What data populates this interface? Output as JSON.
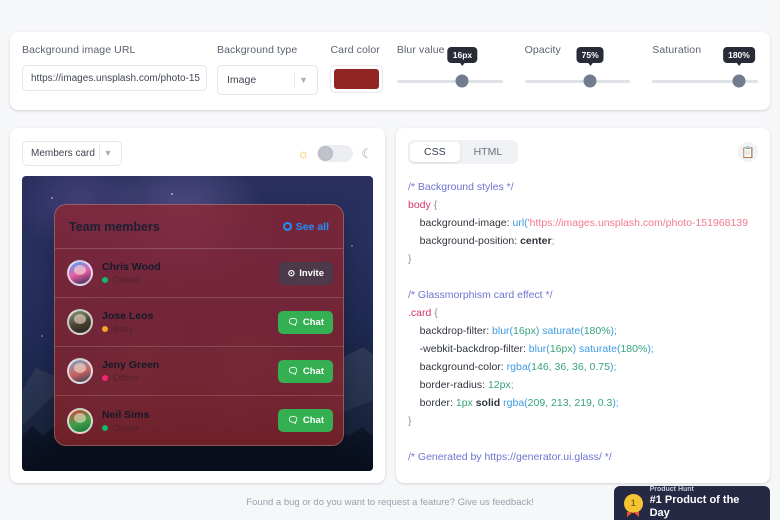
{
  "controls": {
    "bg_url": {
      "label": "Background image URL",
      "value": "https://images.unsplash.com/photo-15"
    },
    "bg_type": {
      "label": "Background type",
      "value": "Image"
    },
    "card_color": {
      "label": "Card color",
      "value": "#922424"
    },
    "blur": {
      "label": "Blur value",
      "value": "16px",
      "knob_pct": 62
    },
    "opacity": {
      "label": "Opacity",
      "value": "75%",
      "knob_pct": 62
    },
    "saturation": {
      "label": "Saturation",
      "value": "180%",
      "knob_pct": 82
    }
  },
  "preview": {
    "component_select": "Members card",
    "theme": {
      "sun_icon": "sun-icon",
      "moon_icon": "moon-icon",
      "state": "light"
    },
    "card": {
      "title": "Team members",
      "see_all": "See all",
      "members": [
        {
          "name": "Chris Wood",
          "status": "Online",
          "status_color": "#12b76a",
          "action": "Invite",
          "action_icon": "invite-icon",
          "action_kind": "invite"
        },
        {
          "name": "Jose Leos",
          "status": "Busy",
          "status_color": "#f5a524",
          "action": "Chat",
          "action_icon": "chat-icon",
          "action_kind": "chat"
        },
        {
          "name": "Jeny Green",
          "status": "Offline",
          "status_color": "#f3256f",
          "action": "Chat",
          "action_icon": "chat-icon",
          "action_kind": "chat"
        },
        {
          "name": "Neil Sims",
          "status": "Online",
          "status_color": "#12b76a",
          "action": "Chat",
          "action_icon": "chat-icon",
          "action_kind": "chat"
        }
      ]
    }
  },
  "code_panel": {
    "tabs": [
      {
        "label": "CSS",
        "active": true
      },
      {
        "label": "HTML",
        "active": false
      }
    ],
    "copy_icon": "clipboard-icon",
    "css": {
      "c1": "/* Background styles */",
      "l1_sel": "body",
      "l1_brace": " {",
      "l2_prop": "    background-image: ",
      "l2_fn": "url(",
      "l2_str": "'https://images.unsplash.com/photo-151968139",
      "l3_prop": "    background-position: ",
      "l3_val": "center",
      "l3_semi": ";",
      "l4": "}",
      "c2": "/* Glassmorphism card effect */",
      "l5_sel": ".card",
      "l5_brace": " {",
      "l6_prop": "    backdrop-filter: ",
      "l6_fn1": "blur(",
      "l6_n1": "16px",
      "l6_mid": ") ",
      "l6_fn2": "saturate(",
      "l6_n2": "180%",
      "l6_end": ");",
      "l7_prop": "    -webkit-backdrop-filter: ",
      "l8_prop": "    background-color: ",
      "l8_fn": "rgba(",
      "l8_n": "146, 36, 36, 0.75",
      "l8_end": ");",
      "l9_prop": "    border-radius: ",
      "l9_n": "12px",
      "l9_end": ";",
      "l10_prop": "    border: ",
      "l10_n": "1px",
      "l10_kw": " solid ",
      "l10_fn": "rgba(",
      "l10_n2": "209, 213, 219, 0.3",
      "l10_end": ");",
      "l11": "}",
      "c3": "/* Generated by https://generator.ui.glass/ */"
    }
  },
  "footer": {
    "feedback_text": "Found a bug or do you want to request a feature? Give us feedback!",
    "product_hunt": {
      "top": "Product Hunt",
      "main": "#1 Product of the Day",
      "medal": "1"
    }
  }
}
